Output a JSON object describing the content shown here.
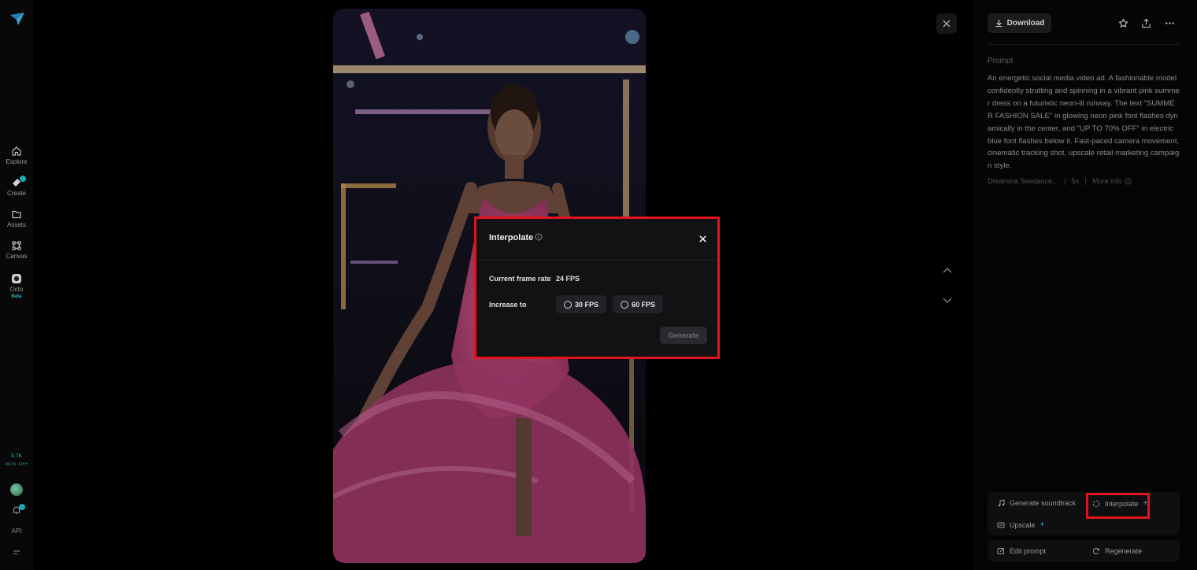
{
  "nav": {
    "items": [
      {
        "label": "Explore",
        "icon": "home-icon"
      },
      {
        "label": "Create",
        "icon": "create-icon"
      },
      {
        "label": "Assets",
        "icon": "folder-icon"
      },
      {
        "label": "Canvas",
        "icon": "canvas-icon"
      },
      {
        "label": "Octo",
        "icon": "octo-icon",
        "tag": "Beta"
      }
    ],
    "credits": "3.7K",
    "credits_sub": "Up to -OFF",
    "api_label": "API"
  },
  "toolbar": {
    "download_label": "Download"
  },
  "prompt": {
    "label": "Prompt",
    "text": "An energetic social media video ad. A fashionable model confidently strutting and spinning in a vibrant pink summer dress on a futuristic neon-lit runway. The text \"SUMMER FASHION SALE\" in glowing neon pink font flashes dynamically in the center, and \"UP TO 70% OFF\" in electric blue font flashes below it. Fast-paced camera movement, cinematic tracking shot, upscale retail marketing campaign style.",
    "model": "Dreamina Seedance...",
    "duration": "5s",
    "more_info": "More info"
  },
  "actions": {
    "soundtrack": "Generate soundtrack",
    "interpolate": "Interpolate",
    "upscale": "Upscale",
    "edit_prompt": "Edit prompt",
    "regenerate": "Regenerate"
  },
  "dialog": {
    "title": "Interpolate",
    "current_label": "Current frame rate",
    "current_value": "24 FPS",
    "increase_label": "Increase to",
    "options": [
      "30 FPS",
      "60 FPS"
    ],
    "generate_label": "Generate"
  },
  "colors": {
    "accent": "#2ab7c7",
    "highlight": "#e0141e"
  }
}
